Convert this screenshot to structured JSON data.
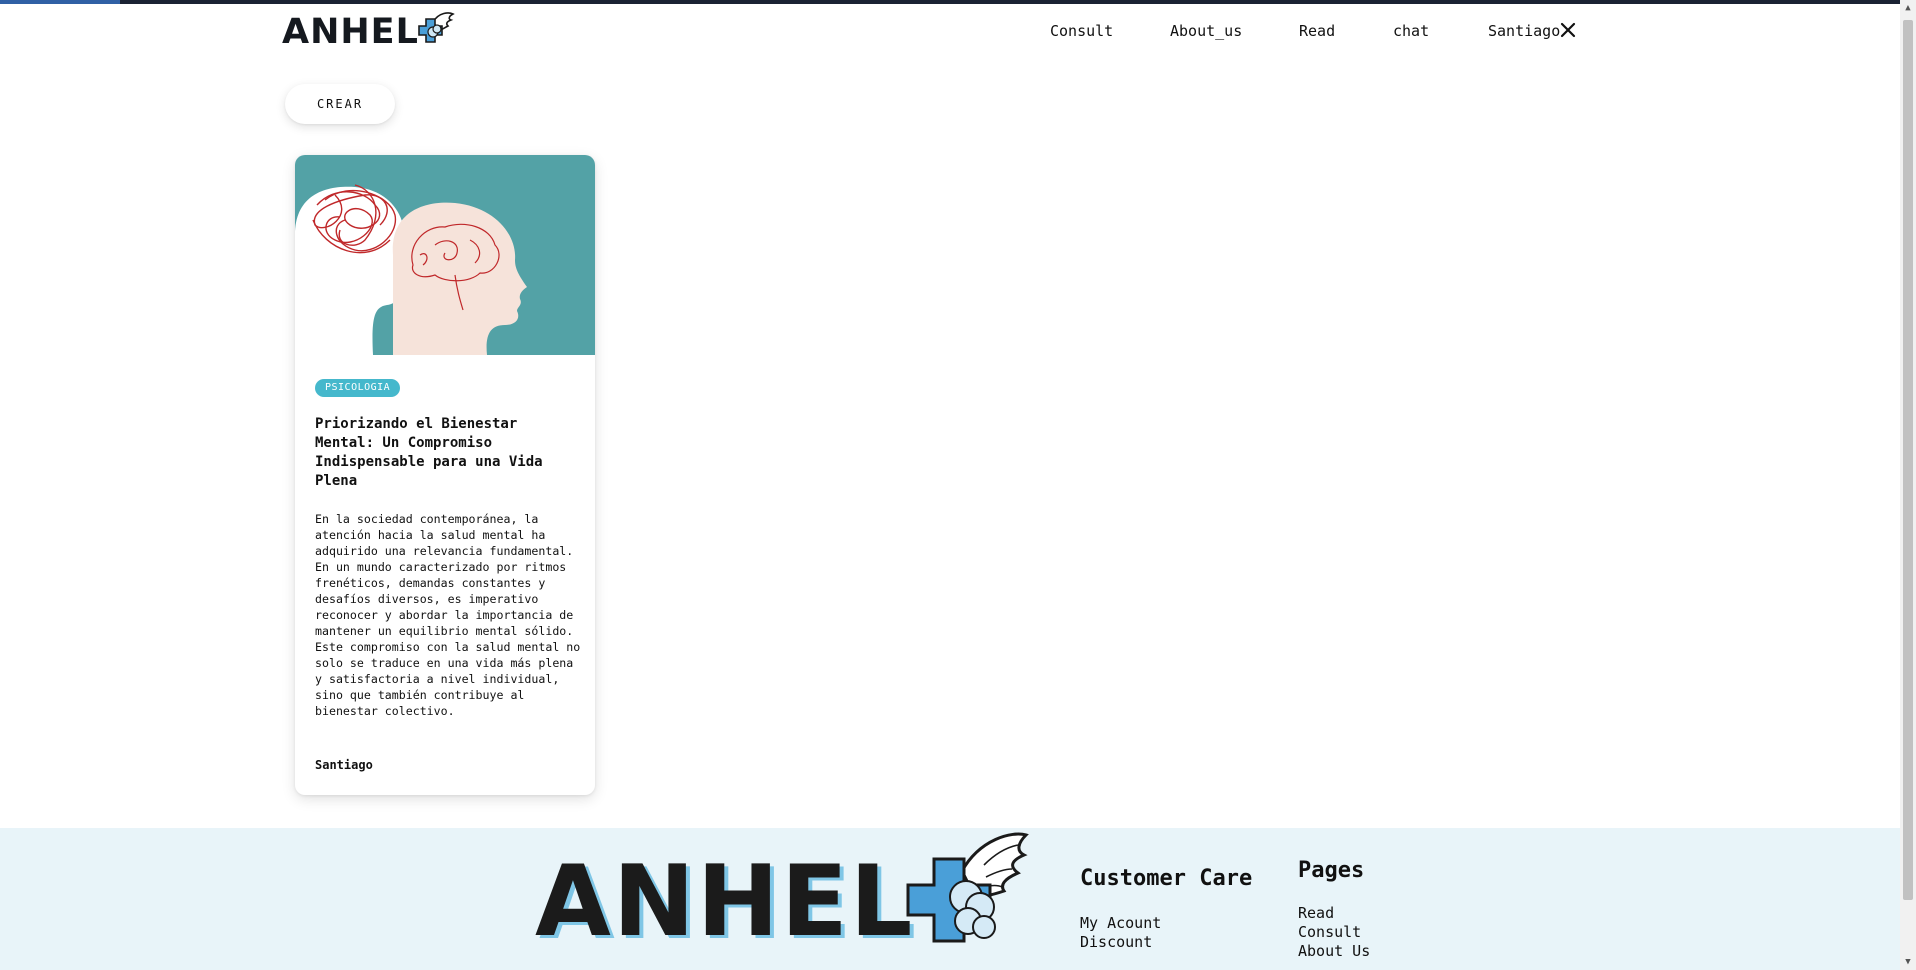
{
  "header": {
    "logo_text": "ANHEL",
    "nav": [
      "Consult",
      "About_us",
      "Read",
      "chat",
      "Santiago"
    ]
  },
  "toolbar": {
    "create_label": "CREAR"
  },
  "post": {
    "category": "PSICOLOGIA",
    "title": "Priorizando el Bienestar Mental: Un Compromiso Indispensable para una Vida Plena",
    "body": "En la sociedad contemporánea, la atención hacia la salud mental ha adquirido una relevancia fundamental. En un mundo caracterizado por ritmos frenéticos, demandas constantes y desafíos diversos, es imperativo reconocer y abordar la importancia de mantener un equilibrio mental sólido. Este compromiso con la salud mental no solo se traduce en una vida más plena y satisfactoria a nivel individual, sino que también contribuye al bienestar colectivo.",
    "author": "Santiago",
    "image_icon": "two-heads-brain-illustration"
  },
  "footer": {
    "logo_text": "ANHEL",
    "customer_care": {
      "title": "Customer Care",
      "links": [
        "My Acount",
        "Discount"
      ]
    },
    "pages": {
      "title": "Pages",
      "links": [
        "Read",
        "Consult",
        "About Us"
      ]
    }
  },
  "colors": {
    "tag": "#45b8cc",
    "image_bg": "#53a2a6",
    "footer_bg": "#e8f4f9",
    "logo_accent": "#4a9fd8"
  }
}
